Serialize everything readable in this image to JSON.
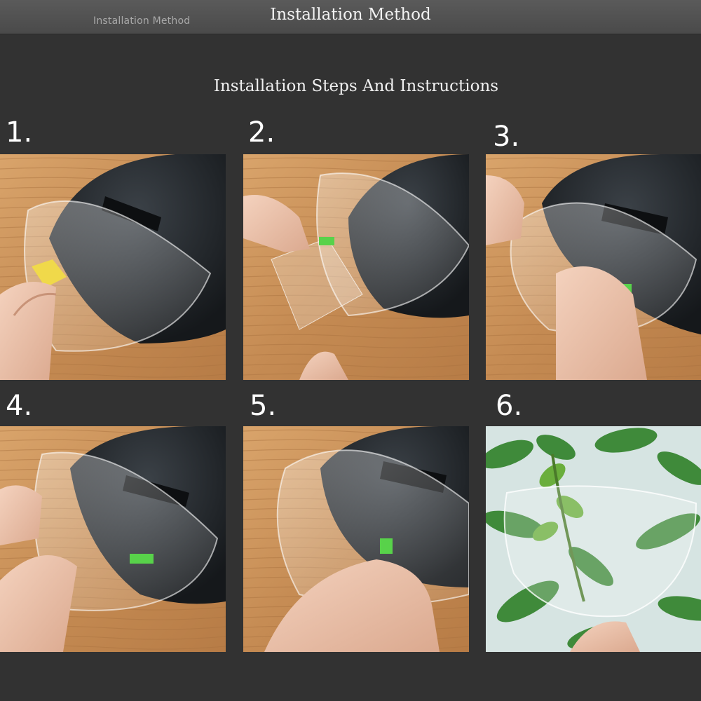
{
  "header": {
    "small_title": "Installation Method",
    "title": "Installation Method"
  },
  "subtitle": "Installation Steps And Instructions",
  "steps": [
    {
      "number": "1."
    },
    {
      "number": "2."
    },
    {
      "number": "3."
    },
    {
      "number": "4."
    },
    {
      "number": "5."
    },
    {
      "number": "6."
    }
  ],
  "colors": {
    "background": "#323232",
    "wood": "#c9925a",
    "helmet": "#1e2226",
    "leaf": "#3f8a3a"
  }
}
